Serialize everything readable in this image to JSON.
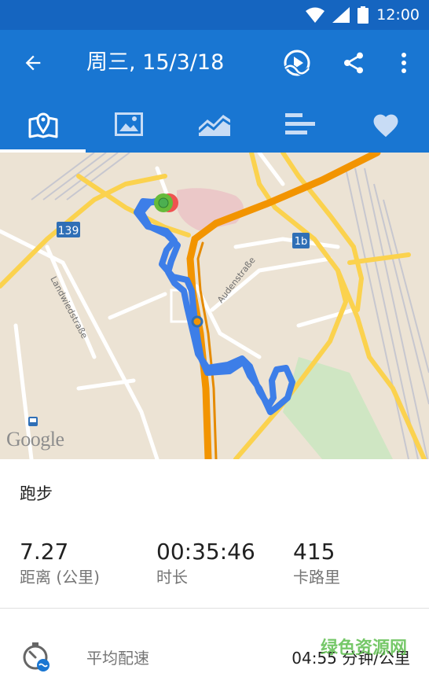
{
  "status_bar": {
    "time": "12:00"
  },
  "toolbar": {
    "title": "周三, 15/3/18",
    "icons": [
      "arrow-back-icon",
      "replay-route-icon",
      "share-icon",
      "more-vert-icon"
    ]
  },
  "tabs": [
    {
      "icon": "map-icon",
      "active": true
    },
    {
      "icon": "photo-icon",
      "active": false
    },
    {
      "icon": "chart-icon",
      "active": false
    },
    {
      "icon": "splits-icon",
      "active": false
    },
    {
      "icon": "heart-icon",
      "active": false
    }
  ],
  "map": {
    "road_labels": {
      "r139": "139",
      "r1b": "1b",
      "landwied": "Landwiedstraße",
      "auden": "Audenstraße"
    },
    "logo": "Google",
    "colors": {
      "route": "#3d7ee8",
      "highway": "#f29400",
      "road": "#fbd24e",
      "start": "#4caf50",
      "end": "#ef5350"
    }
  },
  "activity": {
    "type": "跑步"
  },
  "stats": [
    {
      "value": "7.27",
      "label": "距离 (公里)"
    },
    {
      "value": "00:35:46",
      "label": "时长"
    },
    {
      "value": "415",
      "label": "卡路里"
    }
  ],
  "pace": {
    "label": "平均配速",
    "value": "04:55 分钟/公里"
  },
  "watermark": "绿色资源网"
}
